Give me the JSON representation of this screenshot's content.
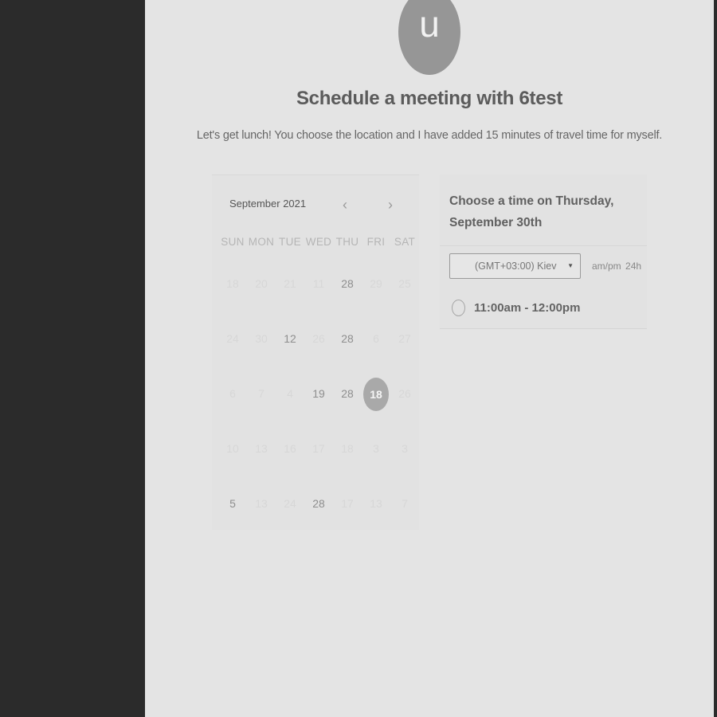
{
  "avatar": {
    "initial": "u"
  },
  "title": "Schedule a meeting with 6test",
  "description": "Let's get lunch! You choose the location and I have added 15 minutes of travel time for myself.",
  "calendar": {
    "month": "September 2021",
    "prev_icon": "chevron-left-icon",
    "next_icon": "chevron-right-icon",
    "weekdays": [
      "SUN",
      "MON",
      "TUE",
      "WED",
      "THU",
      "FRI",
      "SAT"
    ],
    "weeks": [
      [
        "18",
        "20",
        "21",
        "11",
        "28",
        "29",
        "25"
      ],
      [
        "24",
        "30",
        "12",
        "26",
        "28",
        "6",
        "27"
      ],
      [
        "6",
        "7",
        "4",
        "19",
        "28",
        "18",
        "26"
      ],
      [
        "10",
        "13",
        "16",
        "17",
        "18",
        "3",
        "3"
      ],
      [
        "5",
        "13",
        "24",
        "28",
        "17",
        "13",
        "7"
      ]
    ],
    "selected": "18"
  },
  "times": {
    "title": "Choose a time on Thursday, September 30th",
    "timezone": "(GMT+03:00) Kiev",
    "format_ampm": "am/pm",
    "format_24h": "24h",
    "slots": [
      "11:00am - 12:00pm"
    ]
  },
  "colors": {
    "background": "#e4e4e4",
    "sidebar": "#2b2b2b",
    "accent": "#a9a9a9"
  }
}
